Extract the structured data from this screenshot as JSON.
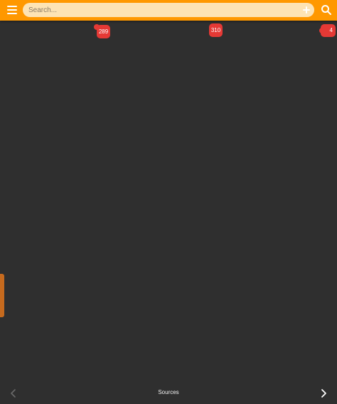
{
  "search": {
    "placeholder": "Search...",
    "value": ""
  },
  "badges": {
    "first": "289",
    "second": "310",
    "third": "4"
  },
  "bottom": {
    "label": "Sources"
  },
  "colors": {
    "accent": "#ff9800",
    "background": "#2f2f2f",
    "badge": "#e53935",
    "handle": "#c66a1e",
    "search_box": "#fde3b4"
  },
  "icons": {
    "menu": "menu-icon",
    "search": "search-icon",
    "add": "plus-icon",
    "prev": "chevron-left-icon",
    "next": "chevron-right-icon"
  }
}
